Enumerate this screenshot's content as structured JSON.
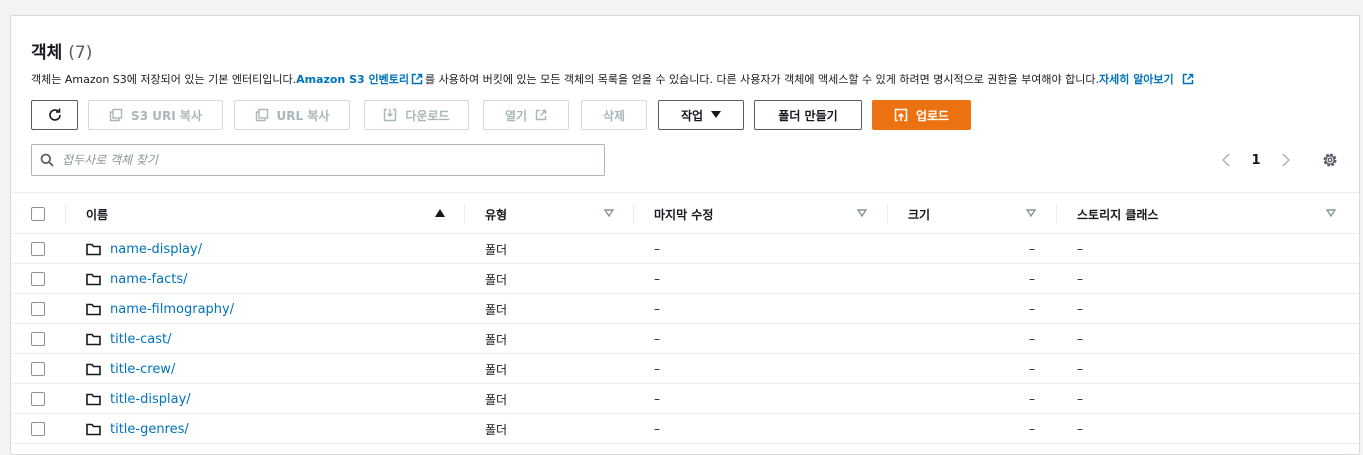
{
  "header": {
    "title": "객체",
    "count": "(7)"
  },
  "description": {
    "part1": "객체는 Amazon S3에 저장되어 있는 기본 엔터티입니다. ",
    "link1": "Amazon S3 인벤토리",
    "part2": "를 사용하여 버킷에 있는 모든 객체의 목록을 얻을 수 있습니다. 다른 사용자가 객체에 액세스할 수 있게 하려면 명시적으로 권한을 부여해야 합니다. ",
    "link2": "자세히 알아보기"
  },
  "toolbar": {
    "refresh_icon": "refresh-icon",
    "copy_s3_uri": "S3 URI 복사",
    "copy_url": "URL 복사",
    "download": "다운로드",
    "open": "열기",
    "delete": "삭제",
    "actions": "작업",
    "create_folder": "폴더 만들기",
    "upload": "업로드"
  },
  "search": {
    "placeholder": "접두사로 객체 찾기",
    "value": ""
  },
  "pagination": {
    "current_page": "1"
  },
  "table": {
    "columns": [
      "이름",
      "유형",
      "마지막 수정",
      "크기",
      "스토리지 클래스"
    ],
    "rows": [
      {
        "name": "name-display/",
        "type": "폴더",
        "modified": "–",
        "size": "–",
        "storage": "–"
      },
      {
        "name": "name-facts/",
        "type": "폴더",
        "modified": "–",
        "size": "–",
        "storage": "–"
      },
      {
        "name": "name-filmography/",
        "type": "폴더",
        "modified": "–",
        "size": "–",
        "storage": "–"
      },
      {
        "name": "title-cast/",
        "type": "폴더",
        "modified": "–",
        "size": "–",
        "storage": "–"
      },
      {
        "name": "title-crew/",
        "type": "폴더",
        "modified": "–",
        "size": "–",
        "storage": "–"
      },
      {
        "name": "title-display/",
        "type": "폴더",
        "modified": "–",
        "size": "–",
        "storage": "–"
      },
      {
        "name": "title-genres/",
        "type": "폴더",
        "modified": "–",
        "size": "–",
        "storage": "–"
      }
    ]
  },
  "colors": {
    "link": "#0073bb",
    "primary": "#ec7211",
    "disabled": "#aab7b8"
  }
}
